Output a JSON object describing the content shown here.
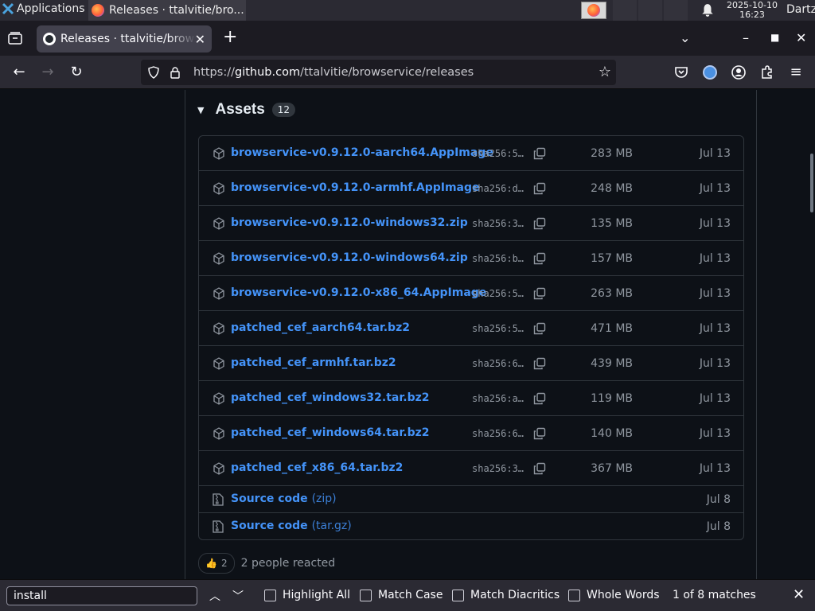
{
  "os_panel": {
    "applications_label": "Applications",
    "task_title": "Releases · ttalvitie/bro...",
    "clock_date": "2025-10-10",
    "clock_time": "16:23",
    "user": "Dartz"
  },
  "browser": {
    "tab_title": "Releases · ttalvitie/browservice",
    "url_prefix": "https://",
    "url_host": "github.com",
    "url_path": "/ttalvitie/browservice/releases"
  },
  "assets": {
    "heading": "Assets",
    "count": "12",
    "files": [
      {
        "name": "browservice-v0.9.12.0-aarch64.AppImage",
        "sha": "sha256:5…",
        "size": "283 MB",
        "date": "Jul 13"
      },
      {
        "name": "browservice-v0.9.12.0-armhf.AppImage",
        "sha": "sha256:d…",
        "size": "248 MB",
        "date": "Jul 13"
      },
      {
        "name": "browservice-v0.9.12.0-windows32.zip",
        "sha": "sha256:3…",
        "size": "135 MB",
        "date": "Jul 13"
      },
      {
        "name": "browservice-v0.9.12.0-windows64.zip",
        "sha": "sha256:b…",
        "size": "157 MB",
        "date": "Jul 13"
      },
      {
        "name": "browservice-v0.9.12.0-x86_64.AppImage",
        "sha": "sha256:5…",
        "size": "263 MB",
        "date": "Jul 13"
      },
      {
        "name": "patched_cef_aarch64.tar.bz2",
        "sha": "sha256:5…",
        "size": "471 MB",
        "date": "Jul 13"
      },
      {
        "name": "patched_cef_armhf.tar.bz2",
        "sha": "sha256:6…",
        "size": "439 MB",
        "date": "Jul 13"
      },
      {
        "name": "patched_cef_windows32.tar.bz2",
        "sha": "sha256:a…",
        "size": "119 MB",
        "date": "Jul 13"
      },
      {
        "name": "patched_cef_windows64.tar.bz2",
        "sha": "sha256:6…",
        "size": "140 MB",
        "date": "Jul 13"
      },
      {
        "name": "patched_cef_x86_64.tar.bz2",
        "sha": "sha256:3…",
        "size": "367 MB",
        "date": "Jul 13"
      }
    ],
    "source": [
      {
        "name": "Source code",
        "format": "(zip)",
        "date": "Jul 8"
      },
      {
        "name": "Source code",
        "format": "(tar.gz)",
        "date": "Jul 8"
      }
    ]
  },
  "reactions": {
    "emoji": "👍",
    "count": "2",
    "summary": "2 people reacted"
  },
  "findbar": {
    "query": "install",
    "highlight_all": "Highlight All",
    "match_case": "Match Case",
    "match_diacritics": "Match Diacritics",
    "whole_words": "Whole Words",
    "matches": "1 of 8 matches"
  }
}
